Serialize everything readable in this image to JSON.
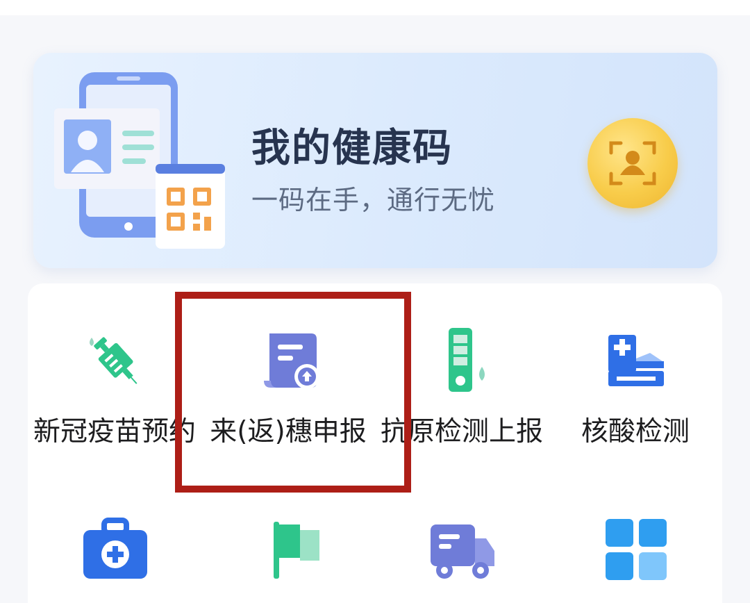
{
  "health_card": {
    "title": "我的健康码",
    "subtitle": "一码在手，通行无忧"
  },
  "services_row1": [
    {
      "label": "新冠疫苗预约",
      "icon": "vaccine-syringe-icon"
    },
    {
      "label": "来(返)穗申报",
      "icon": "document-upload-icon"
    },
    {
      "label": "抗原检测上报",
      "icon": "test-tube-icon"
    },
    {
      "label": "核酸检测",
      "icon": "medical-bed-icon"
    }
  ],
  "services_row2": [
    {
      "icon": "first-aid-kit-icon"
    },
    {
      "icon": "flag-icon"
    },
    {
      "icon": "truck-icon"
    },
    {
      "icon": "apps-grid-icon"
    }
  ],
  "colors": {
    "accent_blue": "#2f6fe6",
    "teal": "#2ec58b",
    "indigo": "#6f7cd8",
    "gold": "#f8cc4a",
    "highlight_red": "#ad1e17"
  }
}
